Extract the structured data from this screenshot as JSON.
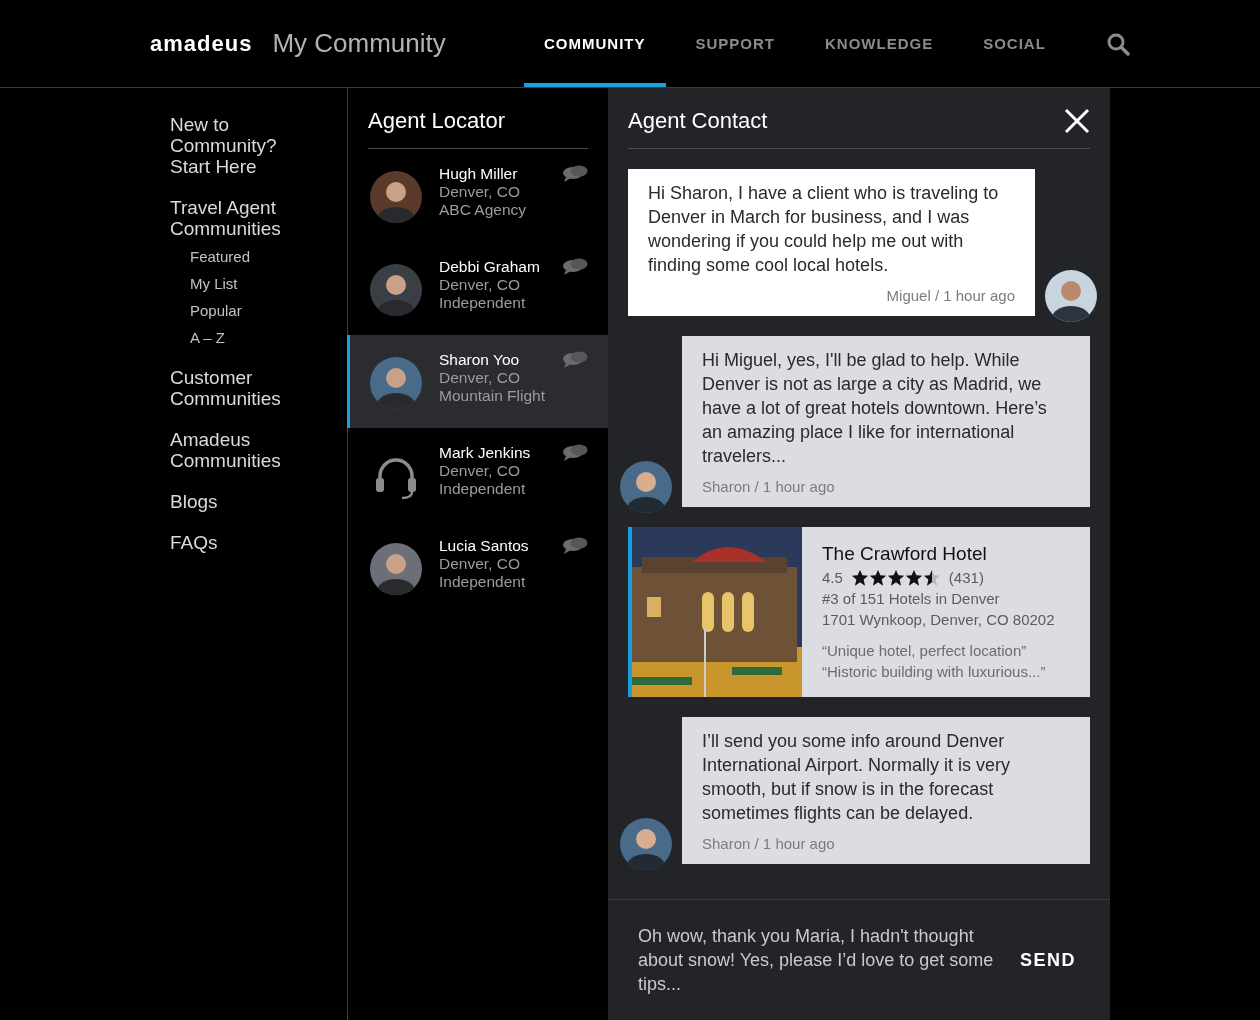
{
  "brand": {
    "logo": "amadeus",
    "product": "My Community"
  },
  "nav": [
    {
      "label": "COMMUNITY",
      "selected": true
    },
    {
      "label": "SUPPORT",
      "selected": false
    },
    {
      "label": "KNOWLEDGE",
      "selected": false
    },
    {
      "label": "SOCIAL",
      "selected": false
    }
  ],
  "sidebar": {
    "items": [
      {
        "label": "New to Community? Start Here"
      },
      {
        "label": "Travel Agent Communities",
        "children": [
          {
            "label": "Featured"
          },
          {
            "label": "My List"
          },
          {
            "label": "Popular"
          },
          {
            "label": "A – Z"
          }
        ]
      },
      {
        "label": "Customer Communities"
      },
      {
        "label": "Amadeus Communities"
      },
      {
        "label": "Blogs"
      },
      {
        "label": "FAQs"
      }
    ]
  },
  "agent_locator": {
    "title": "Agent Locator",
    "agents": [
      {
        "name": "Hugh Miller",
        "location": "Denver, CO",
        "agency": "ABC Agency",
        "selected": false
      },
      {
        "name": "Debbi Graham",
        "location": "Denver, CO",
        "agency": "Independent",
        "selected": false
      },
      {
        "name": "Sharon Yoo",
        "location": "Denver, CO",
        "agency": "Mountain Flight",
        "selected": true
      },
      {
        "name": "Mark Jenkins",
        "location": "Denver, CO",
        "agency": "Independent",
        "kind": "headset",
        "selected": false
      },
      {
        "name": "Lucia Santos",
        "location": "Denver, CO",
        "agency": "Independent",
        "selected": false
      }
    ]
  },
  "agent_contact": {
    "title": "Agent Contact",
    "messages": [
      {
        "kind": "incoming",
        "text": "Hi Sharon, I have a client who is traveling to Denver in March for business, and I was wondering if you could help me out with finding some cool local hotels.",
        "meta": "Miguel / 1 hour ago"
      },
      {
        "kind": "outgoing",
        "text": "Hi Miguel, yes, I'll be glad to help. While Denver is not as large a city as Madrid, we have a lot of great hotels downtown. Here’s an amazing place I like for international travelers...",
        "meta": "Sharon / 1 hour ago"
      },
      {
        "kind": "hotel",
        "name": "The Crawford Hotel",
        "rating": "4.5",
        "stars": 4.5,
        "reviews": "(431)",
        "rank": "#3 of 151 Hotels in Denver",
        "address": "1701 Wynkoop, Denver, CO 80202",
        "quotes": [
          "“Unique hotel, perfect location”",
          "“Historic building with luxurious...”"
        ]
      },
      {
        "kind": "outgoing",
        "text": "I’ll send you some info around Denver International Airport. Normally it is very smooth, but if snow is in the forecast sometimes flights can be delayed.",
        "meta": "Sharon / 1 hour ago"
      }
    ],
    "compose": {
      "value": "Oh wow, thank you Maria, I hadn't thought about snow! Yes, please I’d love to get some tips...",
      "send": "SEND"
    }
  }
}
